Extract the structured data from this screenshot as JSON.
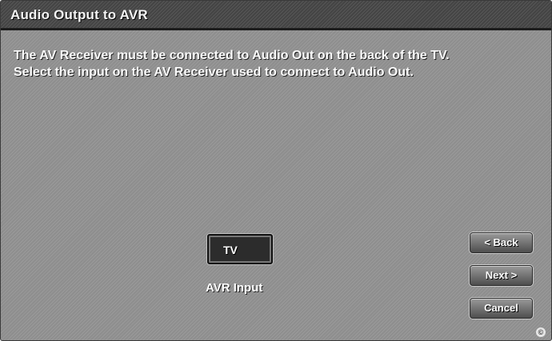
{
  "window": {
    "title": "Audio Output to AVR"
  },
  "instructions": {
    "line1": "The AV Receiver must be connected to Audio Out on the back of the TV.",
    "line2": "Select the input on the AV Receiver used to connect to Audio Out."
  },
  "avr_input": {
    "selected_value": "TV",
    "label": "AVR Input"
  },
  "buttons": {
    "back": "< Back",
    "next": "Next >",
    "cancel": "Cancel"
  },
  "corner_mark": "©"
}
